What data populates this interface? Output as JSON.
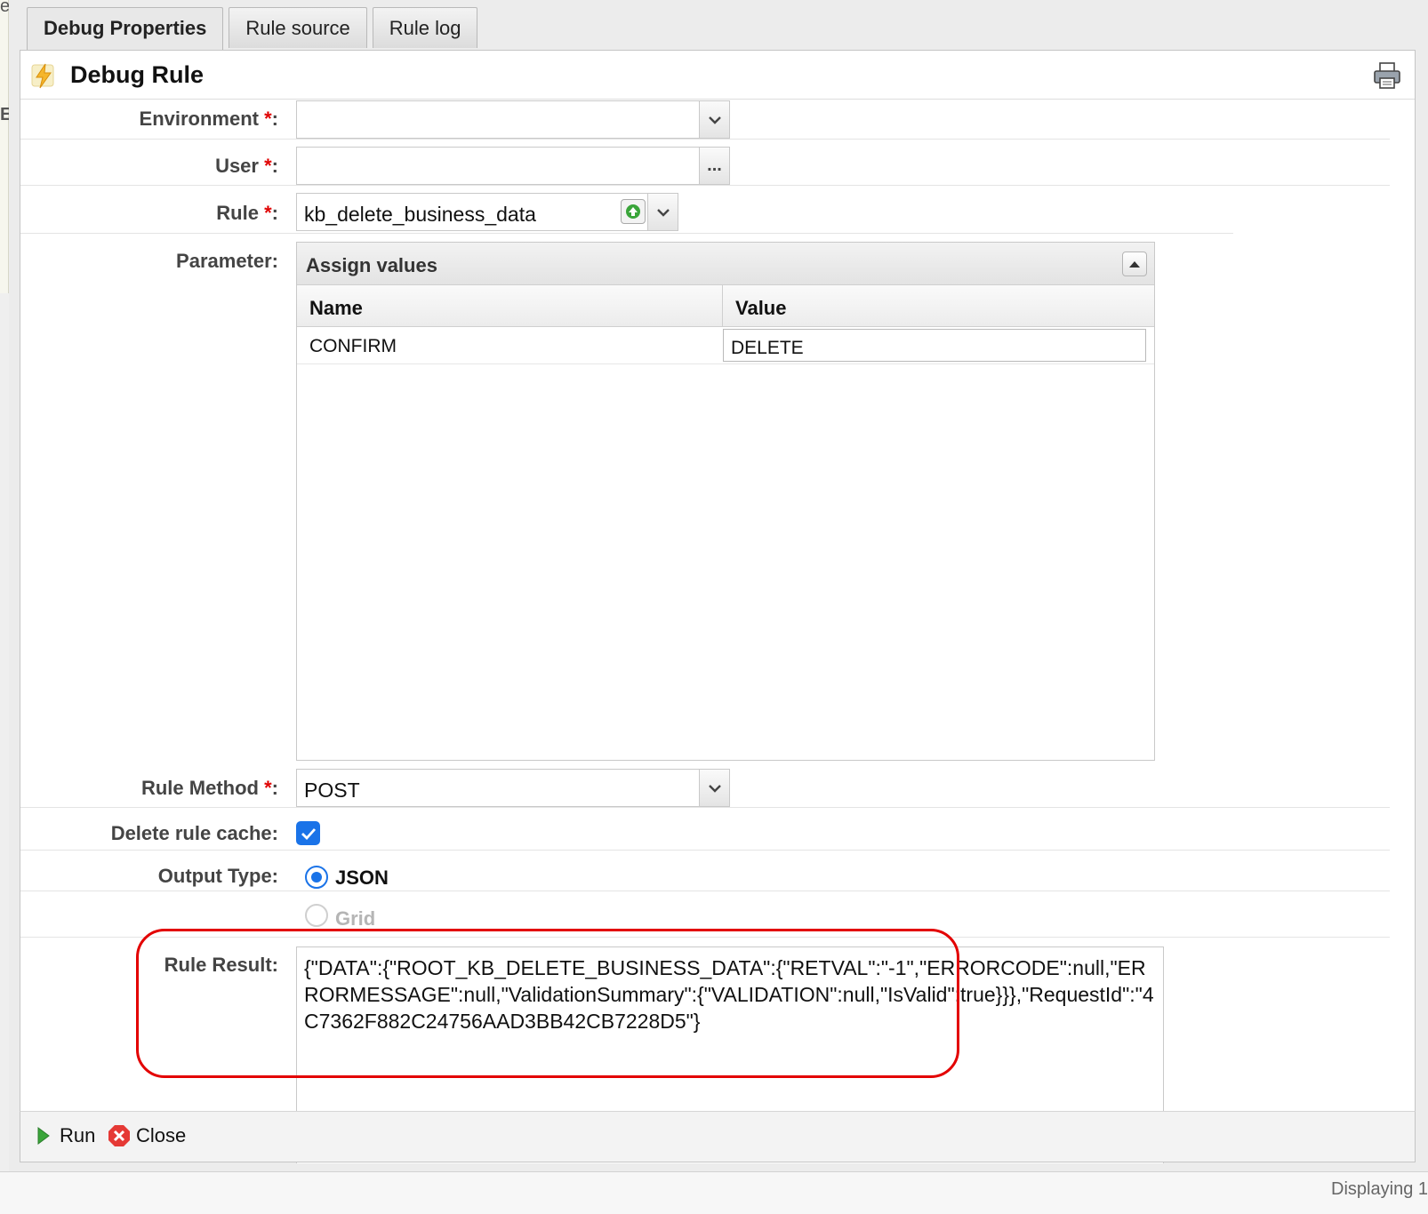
{
  "background": {
    "gutter_chars": [
      "e",
      "E"
    ]
  },
  "tabs": [
    {
      "label": "Debug Properties",
      "active": true
    },
    {
      "label": "Rule source",
      "active": false
    },
    {
      "label": "Rule log",
      "active": false
    }
  ],
  "panel": {
    "title": "Debug Rule",
    "icons": {
      "title": "bolt-icon",
      "print": "printer-icon"
    }
  },
  "form": {
    "environment": {
      "label": "Environment",
      "required_mark": "*",
      "value": ""
    },
    "user": {
      "label": "User",
      "required_mark": "*",
      "value": "",
      "browse_label": "..."
    },
    "rule": {
      "label": "Rule",
      "required_mark": "*",
      "value": "kb_delete_business_data"
    },
    "parameter": {
      "label": "Parameter:",
      "grid_title": "Assign values",
      "columns": [
        "Name",
        "Value"
      ],
      "rows": [
        {
          "name": "CONFIRM",
          "value": "DELETE"
        }
      ]
    },
    "rule_method": {
      "label": "Rule Method",
      "required_mark": "*",
      "value": "POST"
    },
    "delete_cache": {
      "label": "Delete rule cache:",
      "checked": true
    },
    "output_type": {
      "label": "Output Type:",
      "options": [
        {
          "label": "JSON",
          "selected": true
        },
        {
          "label": "Grid",
          "selected": false
        }
      ]
    },
    "rule_result": {
      "label": "Rule Result:",
      "value": "{\"DATA\":{\"ROOT_KB_DELETE_BUSINESS_DATA\":{\"RETVAL\":\"-1\",\"ERRORCODE\":null,\"ERRORMESSAGE\":null,\"ValidationSummary\":{\"VALIDATION\":null,\"IsValid\":true}}},\"RequestId\":\"4C7362F882C24756AAD3BB42CB7228D5\"}"
    }
  },
  "footer": {
    "run_label": "Run",
    "close_label": "Close"
  },
  "status": {
    "text": "Displaying 1"
  },
  "colors": {
    "accent": "#1a73e8",
    "required": "#e00000",
    "highlight": "#e30000"
  }
}
